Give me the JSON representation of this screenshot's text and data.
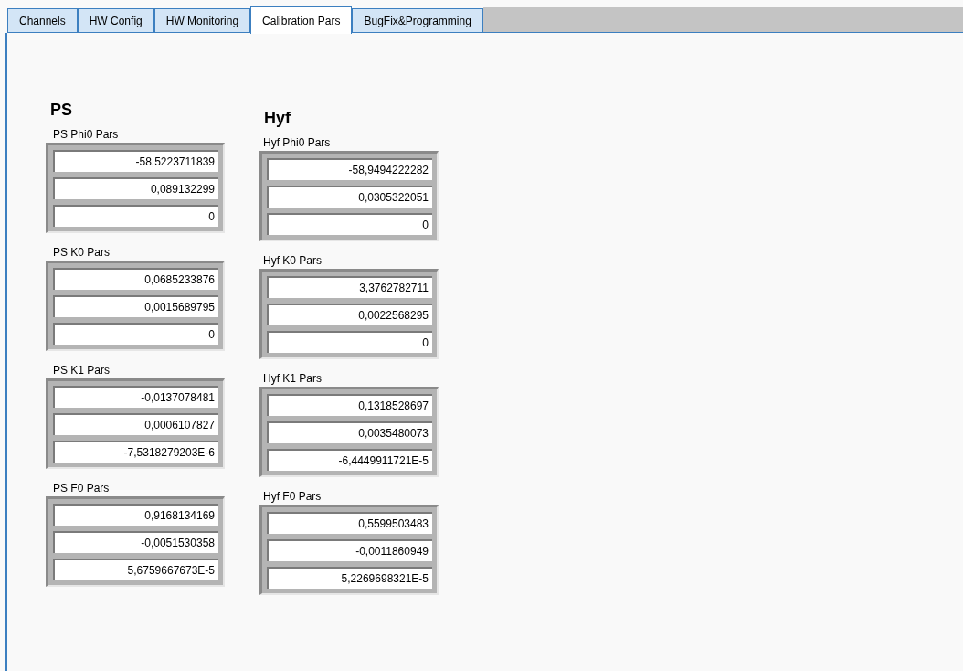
{
  "tabs": [
    {
      "label": "Channels",
      "selected": false
    },
    {
      "label": "HW Config",
      "selected": false
    },
    {
      "label": "HW Monitoring",
      "selected": false
    },
    {
      "label": "Calibration Pars",
      "selected": true
    },
    {
      "label": "BugFix&Programming",
      "selected": false
    }
  ],
  "columns": [
    {
      "heading": "PS",
      "groups": [
        {
          "label": "PS Phi0 Pars",
          "values": [
            "-58,5223711839",
            "0,089132299",
            "0"
          ]
        },
        {
          "label": "PS K0 Pars",
          "values": [
            "0,0685233876",
            "0,0015689795",
            "0"
          ]
        },
        {
          "label": "PS K1 Pars",
          "values": [
            "-0,0137078481",
            "0,0006107827",
            "-7,5318279203E-6"
          ]
        },
        {
          "label": "PS F0 Pars",
          "values": [
            "0,9168134169",
            "-0,0051530358",
            "5,6759667673E-5"
          ]
        }
      ]
    },
    {
      "heading": "Hyf",
      "groups": [
        {
          "label": "Hyf Phi0 Pars",
          "values": [
            "-58,9494222282",
            "0,0305322051",
            "0"
          ]
        },
        {
          "label": "Hyf K0 Pars",
          "values": [
            "3,3762782711",
            "0,0022568295",
            "0"
          ]
        },
        {
          "label": "Hyf K1 Pars",
          "values": [
            "0,1318528697",
            "0,0035480073",
            "-6,4449911721E-5"
          ]
        },
        {
          "label": "Hyf F0 Pars",
          "values": [
            "0,5599503483",
            "-0,0011860949",
            "5,2269698321E-5"
          ]
        }
      ]
    }
  ]
}
